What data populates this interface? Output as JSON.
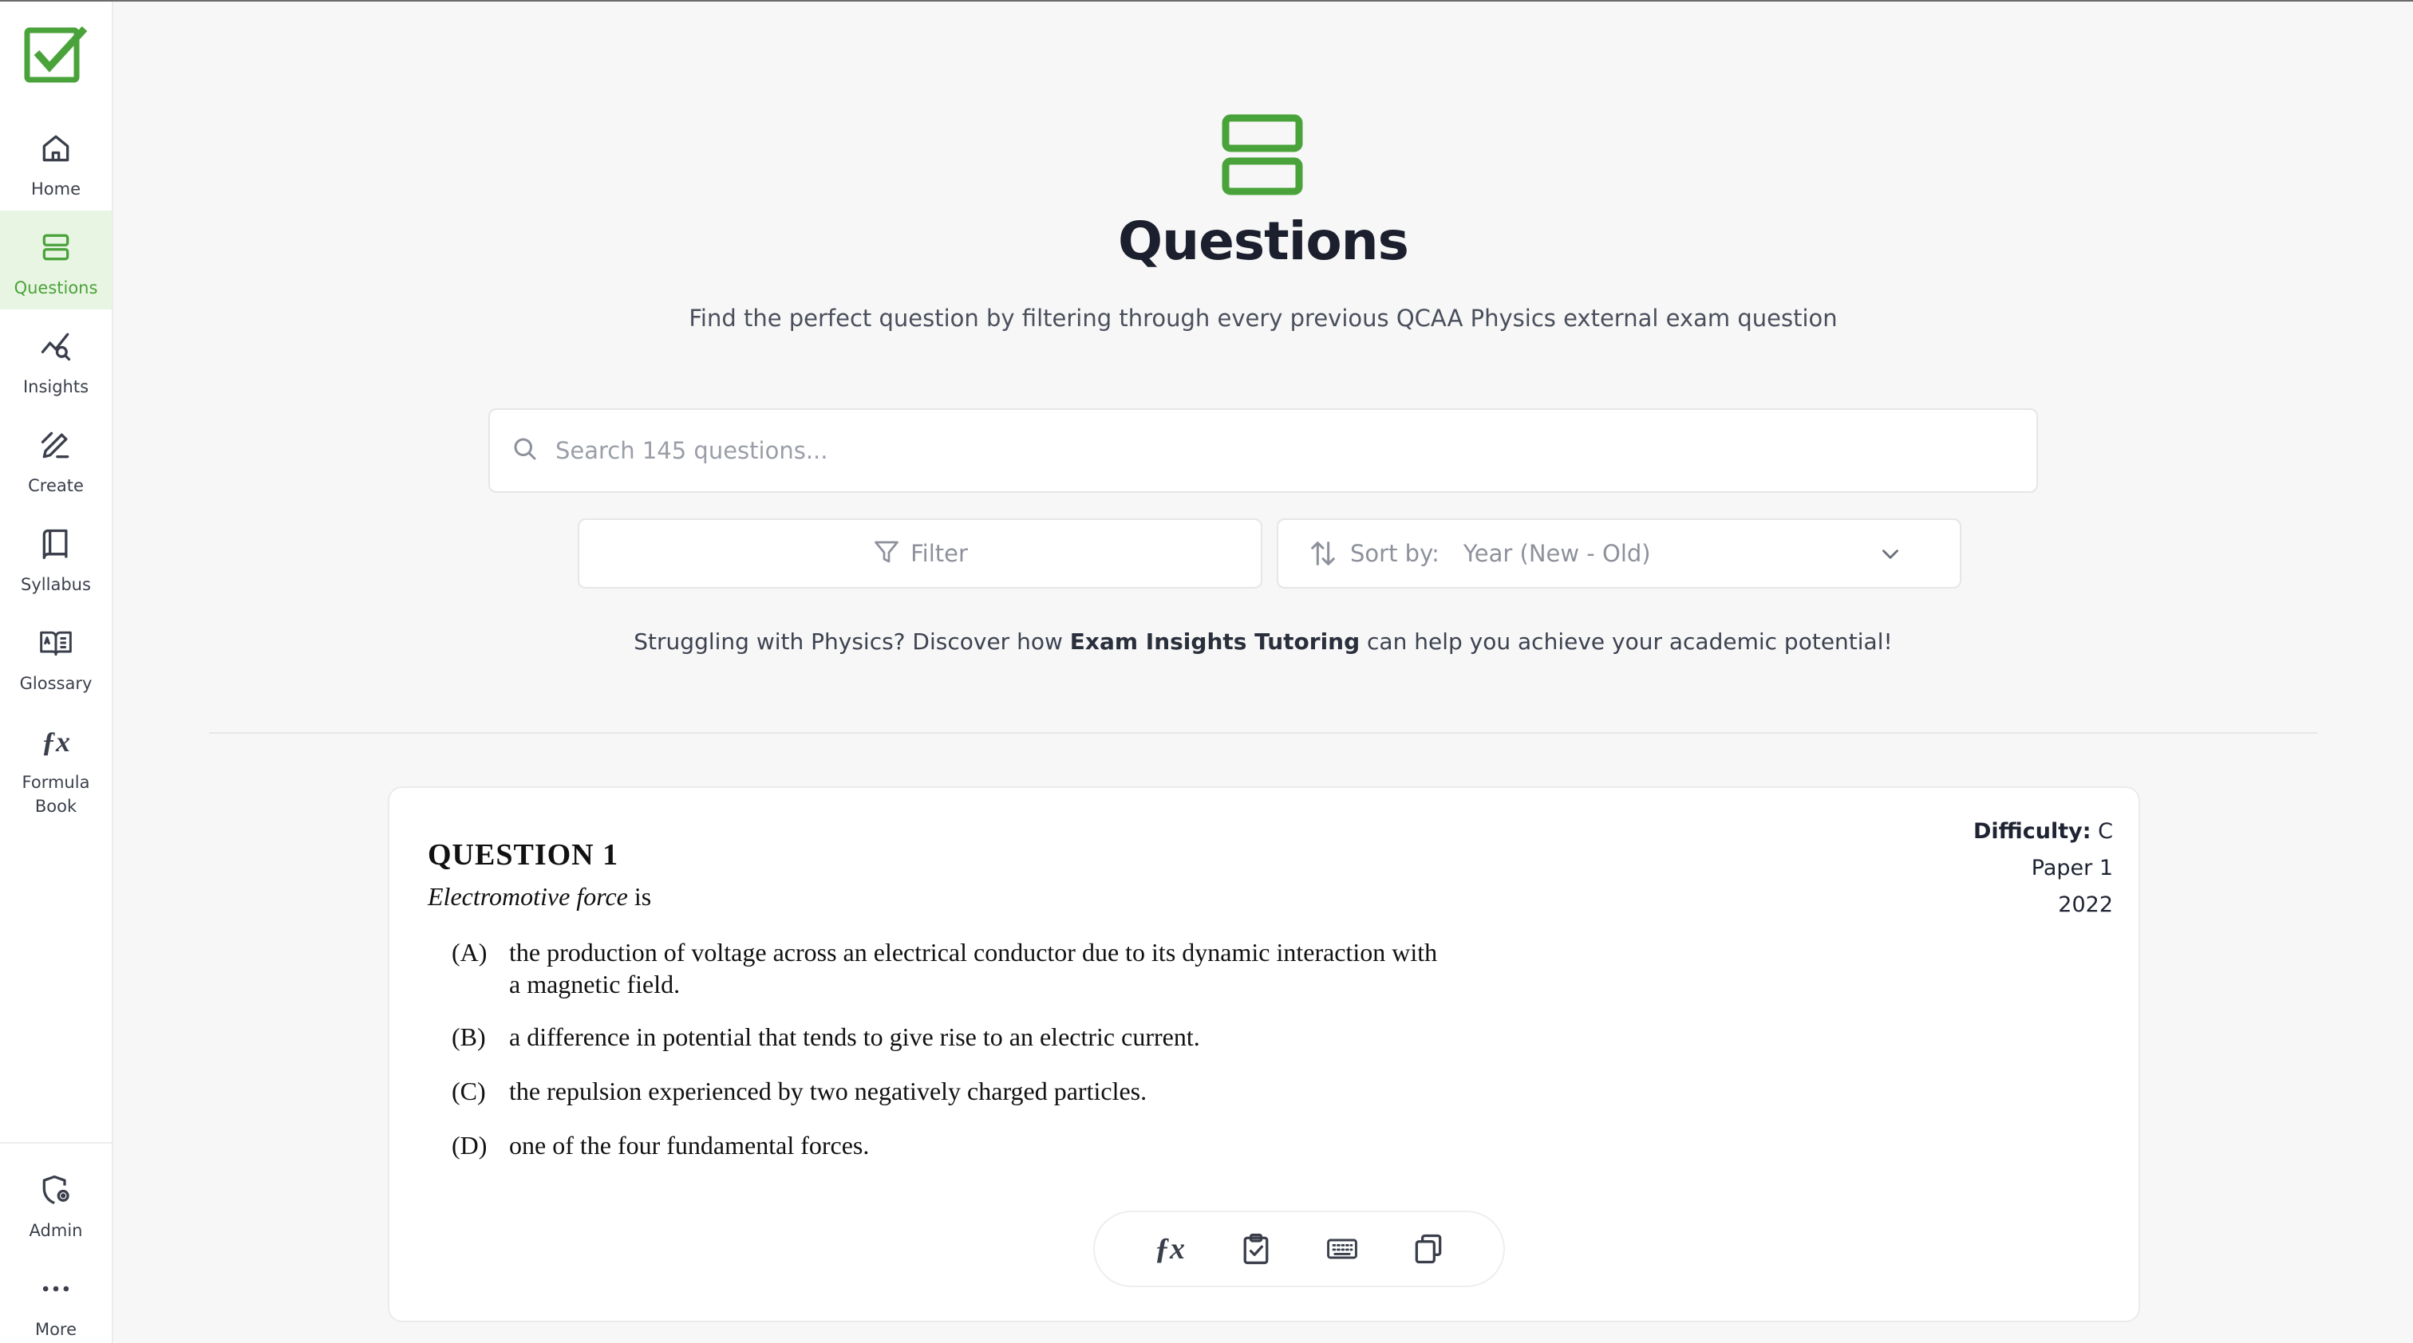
{
  "colors": {
    "brand_green": "#4aa33a",
    "active_bg": "#e9f5e3",
    "text_dark": "#1b1f2e",
    "text_muted": "#8d919b"
  },
  "sidebar": {
    "logo_icon": "check-square-icon",
    "items": [
      {
        "label": "Home",
        "icon": "home-icon",
        "active": false
      },
      {
        "label": "Questions",
        "icon": "stack-icon",
        "active": true
      },
      {
        "label": "Insights",
        "icon": "chart-search-icon",
        "active": false
      },
      {
        "label": "Create",
        "icon": "pen-icon",
        "active": false
      },
      {
        "label": "Syllabus",
        "icon": "book-icon",
        "active": false
      },
      {
        "label": "Glossary",
        "icon": "open-book-icon",
        "active": false
      },
      {
        "label": "Formula Book",
        "label_line1": "Formula",
        "label_line2": "Book",
        "icon": "fx-icon",
        "active": false
      }
    ],
    "bottom_items": [
      {
        "label": "Admin",
        "icon": "shield-gear-icon"
      },
      {
        "label": "More",
        "icon": "more-dots-icon"
      }
    ]
  },
  "header": {
    "title": "Questions",
    "subtitle": "Find the perfect question by filtering through every previous QCAA Physics external exam question",
    "icon": "stack-icon"
  },
  "search": {
    "placeholder": "Search 145 questions...",
    "value": ""
  },
  "filter": {
    "label": "Filter",
    "icon": "filter-icon"
  },
  "sort": {
    "prefix": "Sort by:",
    "value": "Year (New - Old)",
    "icon": "sort-arrows-icon"
  },
  "promo": {
    "before": "Struggling with Physics? Discover how ",
    "link": "Exam Insights Tutoring",
    "after": " can help you achieve your academic potential!"
  },
  "question": {
    "title": "QUESTION 1",
    "stem_italic": "Electromotive force",
    "stem_rest": " is",
    "options": [
      {
        "letter": "(A)",
        "line1": "the production of voltage across an electrical conductor due to its dynamic interaction with",
        "line2": "a magnetic field."
      },
      {
        "letter": "(B)",
        "line1": "a difference in potential that tends to give rise to an electric current."
      },
      {
        "letter": "(C)",
        "line1": "the repulsion experienced by two negatively charged particles."
      },
      {
        "letter": "(D)",
        "line1": "one of the four fundamental forces."
      }
    ],
    "difficulty_label": "Difficulty:",
    "difficulty_value": "C",
    "paper": "Paper 1",
    "year": "2022",
    "toolbar": [
      "fx-icon",
      "clipboard-check-icon",
      "keyboard-icon",
      "copy-icon"
    ]
  }
}
